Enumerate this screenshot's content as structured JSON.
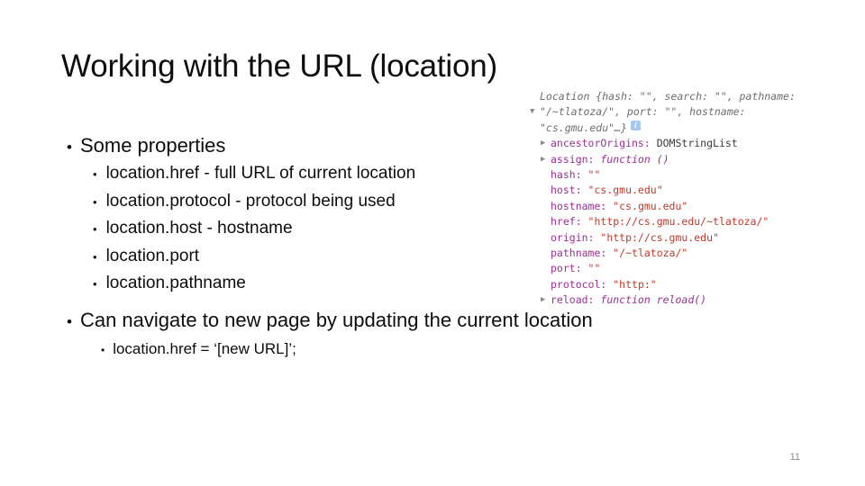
{
  "slide": {
    "title": "Working with the URL (location)",
    "page_number": "11"
  },
  "body": {
    "bullet_some_properties": "Some properties",
    "properties": [
      "location.href - full URL of current location",
      "location.protocol - protocol being used",
      "location.host - hostname",
      "location.port",
      "location.pathname"
    ],
    "bullet_can_navigate": "Can navigate to new page by updating the current location",
    "href_assignment_example": "location.href = ‘[new URL]’;"
  },
  "console": {
    "header": {
      "line1": "Location {hash: \"\", search: \"\", pathname:",
      "line2": "\"/~tlatoza/\", port: \"\", hostname:",
      "line3": "\"cs.gmu.edu\"…}",
      "info_badge": "i",
      "expanded_triangle": "▼"
    },
    "collapsed_triangle": "▶",
    "rows": [
      {
        "triangle": true,
        "key": "ancestorOrigins",
        "sep": ": ",
        "value": "DOMStringList",
        "value_kind": "plain"
      },
      {
        "triangle": true,
        "key": "assign",
        "sep": ": ",
        "value": "function ()",
        "value_kind": "fn"
      },
      {
        "triangle": false,
        "key": "hash",
        "sep": ": ",
        "value": "\"\"",
        "value_kind": "str"
      },
      {
        "triangle": false,
        "key": "host",
        "sep": ": ",
        "value": "\"cs.gmu.edu\"",
        "value_kind": "str"
      },
      {
        "triangle": false,
        "key": "hostname",
        "sep": ": ",
        "value": "\"cs.gmu.edu\"",
        "value_kind": "str"
      },
      {
        "triangle": false,
        "key": "href",
        "sep": ": ",
        "value": "\"http://cs.gmu.edu/~tlatoza/\"",
        "value_kind": "str"
      },
      {
        "triangle": false,
        "key": "origin",
        "sep": ": ",
        "value": "\"http://cs.gmu.edu\"",
        "value_kind": "str"
      },
      {
        "triangle": false,
        "key": "pathname",
        "sep": ": ",
        "value": "\"/~tlatoza/\"",
        "value_kind": "str"
      },
      {
        "triangle": false,
        "key": "port",
        "sep": ": ",
        "value": "\"\"",
        "value_kind": "str"
      },
      {
        "triangle": false,
        "key": "protocol",
        "sep": ": ",
        "value": "\"http:\"",
        "value_kind": "str"
      },
      {
        "triangle": true,
        "key": "reload",
        "sep": ": ",
        "value": "function reload()",
        "value_kind": "fn"
      }
    ]
  },
  "colors": {
    "key": "#9b2f94",
    "string": "#c0392b",
    "plain": "#3a3a3a",
    "dim": "#6e6e6e",
    "badge": "#a8c7f0",
    "text": "#0d0d0d",
    "page_number": "#8c8c8c"
  }
}
